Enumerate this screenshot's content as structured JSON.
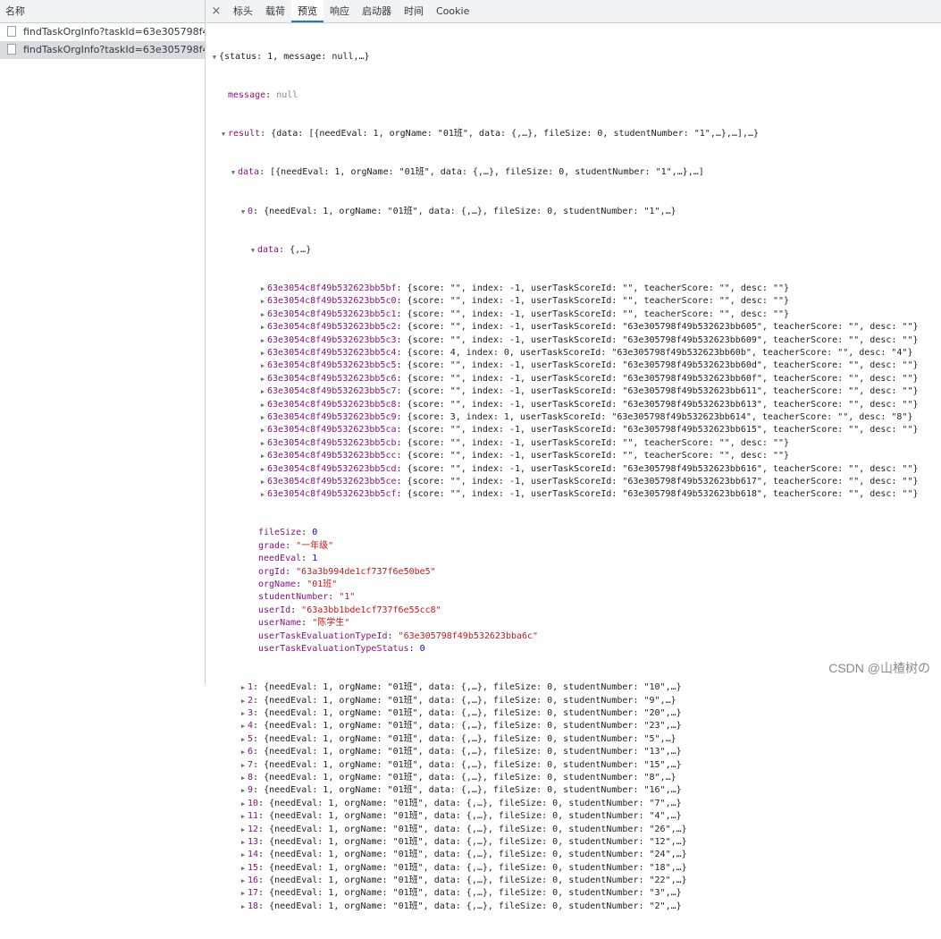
{
  "left": {
    "header": "名称",
    "requests": [
      "findTaskOrgInfo?taskId=63e305798f49b...",
      "findTaskOrgInfo?taskId=63e305798f49b..."
    ]
  },
  "tabs": [
    "标头",
    "载荷",
    "预览",
    "响应",
    "启动器",
    "时间",
    "Cookie"
  ],
  "close_glyph": "×",
  "root": {
    "summary": "{status: 1, message: null,…}",
    "message_key": "message",
    "message_val": "null",
    "result_key": "result",
    "result_summary": "{data: [{needEval: 1, orgName: \"01班\", data: {,…}, fileSize: 0, studentNumber: \"1\",…},…],…}",
    "data_key": "data",
    "data_summary": "[{needEval: 1, orgName: \"01班\", data: {,…}, fileSize: 0, studentNumber: \"1\",…},…]",
    "item0_key": "0",
    "item0_summary": "{needEval: 1, orgName: \"01班\", data: {,…}, fileSize: 0, studentNumber: \"1\",…}",
    "inner_data_key": "data",
    "inner_data_summary": "{,…}"
  },
  "inner_entries": [
    {
      "k": "63e3054c8f49b532623bb5bf",
      "v": "{score: \"\", index: -1, userTaskScoreId: \"\", teacherScore: \"\", desc: \"\"}"
    },
    {
      "k": "63e3054c8f49b532623bb5c0",
      "v": "{score: \"\", index: -1, userTaskScoreId: \"\", teacherScore: \"\", desc: \"\"}"
    },
    {
      "k": "63e3054c8f49b532623bb5c1",
      "v": "{score: \"\", index: -1, userTaskScoreId: \"\", teacherScore: \"\", desc: \"\"}"
    },
    {
      "k": "63e3054c8f49b532623bb5c2",
      "v": "{score: \"\", index: -1, userTaskScoreId: \"63e305798f49b532623bb605\", teacherScore: \"\", desc: \"\"}"
    },
    {
      "k": "63e3054c8f49b532623bb5c3",
      "v": "{score: \"\", index: -1, userTaskScoreId: \"63e305798f49b532623bb609\", teacherScore: \"\", desc: \"\"}"
    },
    {
      "k": "63e3054c8f49b532623bb5c4",
      "v": "{score: 4, index: 0, userTaskScoreId: \"63e305798f49b532623bb60b\", teacherScore: \"\", desc: \"4\"}"
    },
    {
      "k": "63e3054c8f49b532623bb5c5",
      "v": "{score: \"\", index: -1, userTaskScoreId: \"63e305798f49b532623bb60d\", teacherScore: \"\", desc: \"\"}"
    },
    {
      "k": "63e3054c8f49b532623bb5c6",
      "v": "{score: \"\", index: -1, userTaskScoreId: \"63e305798f49b532623bb60f\", teacherScore: \"\", desc: \"\"}"
    },
    {
      "k": "63e3054c8f49b532623bb5c7",
      "v": "{score: \"\", index: -1, userTaskScoreId: \"63e305798f49b532623bb611\", teacherScore: \"\", desc: \"\"}"
    },
    {
      "k": "63e3054c8f49b532623bb5c8",
      "v": "{score: \"\", index: -1, userTaskScoreId: \"63e305798f49b532623bb613\", teacherScore: \"\", desc: \"\"}"
    },
    {
      "k": "63e3054c8f49b532623bb5c9",
      "v": "{score: 3, index: 1, userTaskScoreId: \"63e305798f49b532623bb614\", teacherScore: \"\", desc: \"8\"}"
    },
    {
      "k": "63e3054c8f49b532623bb5ca",
      "v": "{score: \"\", index: -1, userTaskScoreId: \"63e305798f49b532623bb615\", teacherScore: \"\", desc: \"\"}"
    },
    {
      "k": "63e3054c8f49b532623bb5cb",
      "v": "{score: \"\", index: -1, userTaskScoreId: \"\", teacherScore: \"\", desc: \"\"}"
    },
    {
      "k": "63e3054c8f49b532623bb5cc",
      "v": "{score: \"\", index: -1, userTaskScoreId: \"\", teacherScore: \"\", desc: \"\"}"
    },
    {
      "k": "63e3054c8f49b532623bb5cd",
      "v": "{score: \"\", index: -1, userTaskScoreId: \"63e305798f49b532623bb616\", teacherScore: \"\", desc: \"\"}"
    },
    {
      "k": "63e3054c8f49b532623bb5ce",
      "v": "{score: \"\", index: -1, userTaskScoreId: \"63e305798f49b532623bb617\", teacherScore: \"\", desc: \"\"}"
    },
    {
      "k": "63e3054c8f49b532623bb5cf",
      "v": "{score: \"\", index: -1, userTaskScoreId: \"63e305798f49b532623bb618\", teacherScore: \"\", desc: \"\"}"
    }
  ],
  "fields": [
    {
      "k": "fileSize",
      "v": "0",
      "t": "num"
    },
    {
      "k": "grade",
      "v": "\"一年级\"",
      "t": "str"
    },
    {
      "k": "needEval",
      "v": "1",
      "t": "num"
    },
    {
      "k": "orgId",
      "v": "\"63a3b994de1cf737f6e50be5\"",
      "t": "str"
    },
    {
      "k": "orgName",
      "v": "\"01班\"",
      "t": "str"
    },
    {
      "k": "studentNumber",
      "v": "\"1\"",
      "t": "str"
    },
    {
      "k": "userId",
      "v": "\"63a3bb1bde1cf737f6e55cc8\"",
      "t": "str"
    },
    {
      "k": "userName",
      "v": "\"陈学生\"",
      "t": "str"
    },
    {
      "k": "userTaskEvaluationTypeId",
      "v": "\"63e305798f49b532623bba6c\"",
      "t": "str"
    },
    {
      "k": "userTaskEvaluationTypeStatus",
      "v": "0",
      "t": "num"
    }
  ],
  "items": [
    {
      "k": "1",
      "v": "{needEval: 1, orgName: \"01班\", data: {,…}, fileSize: 0, studentNumber: \"10\",…}"
    },
    {
      "k": "2",
      "v": "{needEval: 1, orgName: \"01班\", data: {,…}, fileSize: 0, studentNumber: \"9\",…}"
    },
    {
      "k": "3",
      "v": "{needEval: 1, orgName: \"01班\", data: {,…}, fileSize: 0, studentNumber: \"20\",…}"
    },
    {
      "k": "4",
      "v": "{needEval: 1, orgName: \"01班\", data: {,…}, fileSize: 0, studentNumber: \"23\",…}"
    },
    {
      "k": "5",
      "v": "{needEval: 1, orgName: \"01班\", data: {,…}, fileSize: 0, studentNumber: \"5\",…}"
    },
    {
      "k": "6",
      "v": "{needEval: 1, orgName: \"01班\", data: {,…}, fileSize: 0, studentNumber: \"13\",…}"
    },
    {
      "k": "7",
      "v": "{needEval: 1, orgName: \"01班\", data: {,…}, fileSize: 0, studentNumber: \"15\",…}"
    },
    {
      "k": "8",
      "v": "{needEval: 1, orgName: \"01班\", data: {,…}, fileSize: 0, studentNumber: \"8\",…}"
    },
    {
      "k": "9",
      "v": "{needEval: 1, orgName: \"01班\", data: {,…}, fileSize: 0, studentNumber: \"16\",…}"
    },
    {
      "k": "10",
      "v": "{needEval: 1, orgName: \"01班\", data: {,…}, fileSize: 0, studentNumber: \"7\",…}"
    },
    {
      "k": "11",
      "v": "{needEval: 1, orgName: \"01班\", data: {,…}, fileSize: 0, studentNumber: \"4\",…}"
    },
    {
      "k": "12",
      "v": "{needEval: 1, orgName: \"01班\", data: {,…}, fileSize: 0, studentNumber: \"26\",…}"
    },
    {
      "k": "13",
      "v": "{needEval: 1, orgName: \"01班\", data: {,…}, fileSize: 0, studentNumber: \"12\",…}"
    },
    {
      "k": "14",
      "v": "{needEval: 1, orgName: \"01班\", data: {,…}, fileSize: 0, studentNumber: \"24\",…}"
    },
    {
      "k": "15",
      "v": "{needEval: 1, orgName: \"01班\", data: {,…}, fileSize: 0, studentNumber: \"18\",…}"
    },
    {
      "k": "16",
      "v": "{needEval: 1, orgName: \"01班\", data: {,…}, fileSize: 0, studentNumber: \"22\",…}"
    },
    {
      "k": "17",
      "v": "{needEval: 1, orgName: \"01班\", data: {,…}, fileSize: 0, studentNumber: \"3\",…}"
    },
    {
      "k": "18",
      "v": "{needEval: 1, orgName: \"01班\", data: {,…}, fileSize: 0, studentNumber: \"2\",…}"
    }
  ],
  "watermark": "CSDN @山楂树の"
}
